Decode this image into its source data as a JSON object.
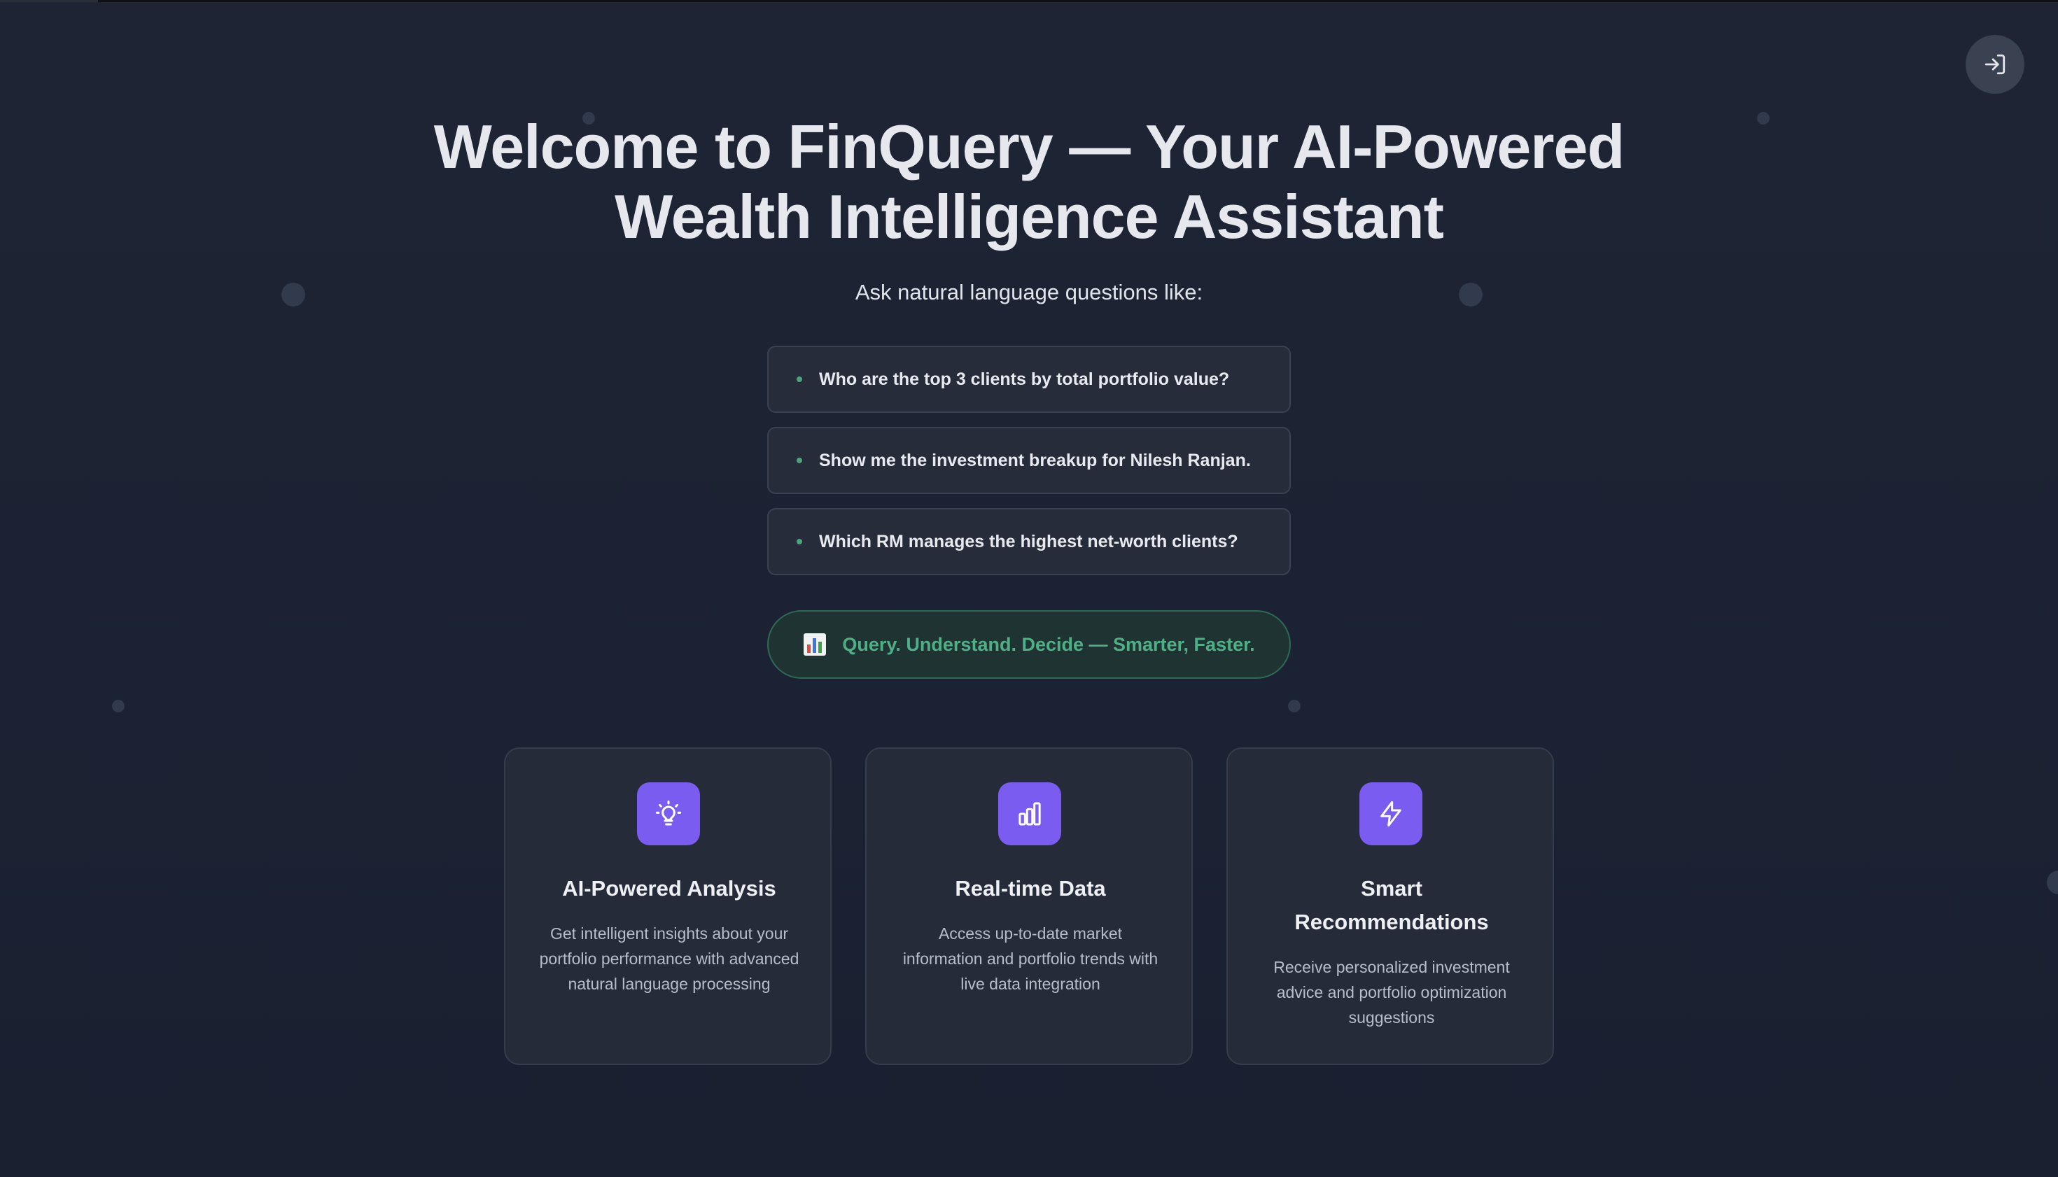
{
  "header": {
    "title_line1": "Welcome to FinQuery — Your AI-Powered",
    "title_line2": "Wealth Intelligence Assistant",
    "subtitle": "Ask natural language questions like:"
  },
  "example_queries": [
    "Who are the top 3 clients by total portfolio value?",
    "Show me the investment breakup for Nilesh Ranjan.",
    "Which RM manages the highest net-worth clients?"
  ],
  "tagline": {
    "icon": "bar-chart-emoji-icon",
    "text": "Query. Understand. Decide — Smarter, Faster."
  },
  "features": [
    {
      "icon": "lightbulb-icon",
      "title": "AI-Powered Analysis",
      "description": "Get intelligent insights about your portfolio performance with advanced natural language processing"
    },
    {
      "icon": "bar-chart-icon",
      "title": "Real-time Data",
      "description": "Access up-to-date market information and portfolio trends with live data integration"
    },
    {
      "icon": "lightning-icon",
      "title": "Smart Recommendations",
      "description": "Receive personalized investment advice and portfolio optimization suggestions"
    }
  ],
  "login_button": {
    "icon": "login-icon"
  },
  "colors": {
    "background": "#1e2433",
    "accent_purple": "#7b5cf0",
    "accent_green": "#4fb086",
    "card": "#252b39"
  }
}
